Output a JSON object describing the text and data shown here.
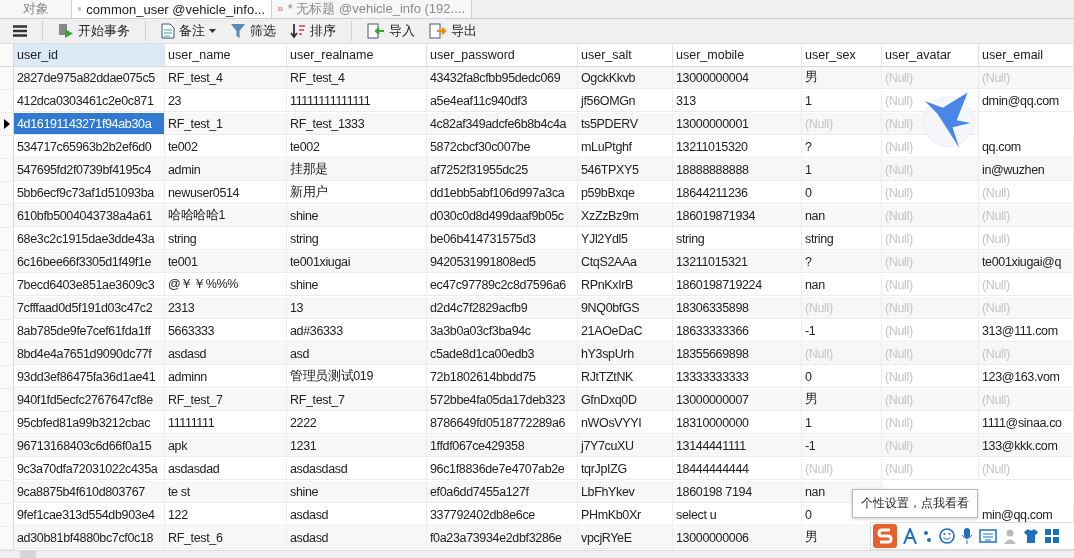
{
  "tabs": [
    {
      "label": "对象",
      "kind": "plain",
      "selected": false
    },
    {
      "label": "common_user @vehicle_info...",
      "kind": "table",
      "selected": true
    },
    {
      "label": "* 无标题 @vehicle_info (192....",
      "kind": "query",
      "selected": false
    }
  ],
  "toolbar": [
    {
      "kind": "menu"
    },
    {
      "kind": "transaction",
      "label": "开始事务"
    },
    {
      "kind": "note",
      "label": "备注"
    },
    {
      "kind": "filter",
      "label": "筛选"
    },
    {
      "kind": "sort",
      "label": "排序"
    },
    {
      "kind": "import",
      "label": "导入"
    },
    {
      "kind": "export",
      "label": "导出"
    }
  ],
  "table": {
    "columns": [
      "user_id",
      "user_name",
      "user_realname",
      "user_password",
      "user_salt",
      "user_mobile",
      "user_sex",
      "user_avatar",
      "user_email"
    ],
    "rows": [
      {
        "selected": false,
        "cells": [
          "2827de975a82ddae075c5",
          "RF_test_4",
          "RF_test_4",
          "43432fa8cfbb95dedc069",
          "OgckKkvb",
          "13000000004",
          "男",
          {
            "kind": "null",
            "text": "(Null)"
          },
          {
            "kind": "null",
            "text": "(Null)"
          }
        ]
      },
      {
        "selected": false,
        "cells": [
          "412dca0303461c2e0c871",
          "23",
          "11111111111111",
          "a5e4eaf11c940df3",
          "jf56OMGn",
          "313",
          "1",
          {
            "kind": "null",
            "text": "(Null)"
          },
          "dmin@qq.com"
        ]
      },
      {
        "selected": true,
        "cells": [
          "4d16191143271f94ab30a",
          "RF_test_1",
          "RF_test_1333",
          "4c82af349adcfe6b8b4c4a",
          "ts5PDERV",
          "13000000001",
          {
            "kind": "null",
            "text": "(Null)"
          },
          {
            "kind": "null",
            "text": "(Null)"
          },
          null
        ]
      },
      {
        "selected": false,
        "cells": [
          "534717c65963b2b2ef6d0",
          "te002",
          "te002",
          "5872cbcf30c007be",
          "mLuPtghf",
          "13211015320",
          "?",
          {
            "kind": "null",
            "text": "(Null)"
          },
          "qq.com"
        ]
      },
      {
        "selected": false,
        "cells": [
          "547695fd2f0739bf4195c4",
          "admin",
          "挂那是",
          "af7252f31955dc25",
          "546TPXY5",
          "18888888888",
          "1",
          {
            "kind": "null",
            "text": "(Null)"
          },
          "in@wuzhen"
        ]
      },
      {
        "selected": false,
        "cells": [
          "5bb6ecf9c73af1d51093ba",
          "newuser0514",
          "新用户",
          "dd1ebb5abf106d997a3ca",
          "p59bBxqe",
          "18644211236",
          "0",
          {
            "kind": "null",
            "text": "(Null)"
          },
          {
            "kind": "null",
            "text": "(Null)"
          }
        ]
      },
      {
        "selected": false,
        "cells": [
          "610bfb5004043738a4a61",
          "哈哈哈哈1",
          "shine",
          "d030c0d8d499daaf9b05c",
          "XzZzBz9m",
          "186019871934",
          "nan",
          {
            "kind": "null",
            "text": "(Null)"
          },
          {
            "kind": "null",
            "text": "(Null)"
          }
        ]
      },
      {
        "selected": false,
        "cells": [
          "68e3c2c1915dae3dde43a",
          "string",
          "string",
          "be06b414731575d3",
          "YJl2Ydl5",
          "string",
          "string",
          {
            "kind": "null",
            "text": "(Null)"
          },
          {
            "kind": "null",
            "text": "(Null)"
          }
        ]
      },
      {
        "selected": false,
        "cells": [
          "6c16bee66f3305d1f49f1e",
          "te001",
          "te001xiugai",
          "9420531991808ed5",
          "CtqS2AAa",
          "13211015321",
          "?",
          {
            "kind": "null",
            "text": "(Null)"
          },
          "te001xiugai@q"
        ]
      },
      {
        "selected": false,
        "cells": [
          "7becd6403e851ae3609c3",
          "@￥￥%%%",
          "shine",
          "ec47c97789c2c8d7596a6",
          "RPnKxIrB",
          "1860198719224",
          "nan",
          {
            "kind": "null",
            "text": "(Null)"
          },
          {
            "kind": "null",
            "text": "(Null)"
          }
        ]
      },
      {
        "selected": false,
        "cells": [
          "7cfffaad0d5f191d03c47c2",
          "2313",
          "13",
          "d2d4c7f2829acfb9",
          "9NQ0bfGS",
          "18306335898",
          {
            "kind": "null",
            "text": "(Null)"
          },
          {
            "kind": "null",
            "text": "(Null)"
          },
          {
            "kind": "null",
            "text": "(Null)"
          }
        ]
      },
      {
        "selected": false,
        "cells": [
          "8ab785de9fe7cef61fda1ff",
          "5663333",
          "ad#36333",
          "3a3b0a03cf3ba94c",
          "21AOeDaC",
          "18633333366",
          "-1",
          {
            "kind": "null",
            "text": "(Null)"
          },
          "313@111.com"
        ]
      },
      {
        "selected": false,
        "cells": [
          "8bd4e4a7651d9090dc77f",
          "asdasd",
          "asd",
          "c5ade8d1ca00edb3",
          "hY3spUrh",
          "18355669898",
          {
            "kind": "null",
            "text": "(Null)"
          },
          {
            "kind": "null",
            "text": "(Null)"
          },
          {
            "kind": "null",
            "text": "(Null)"
          }
        ]
      },
      {
        "selected": false,
        "cells": [
          "93dd3ef86475fa36d1ae41",
          "adminn",
          "管理员测试019",
          "72b1802614bbdd75",
          "RJtTZtNK",
          "13333333333",
          "0",
          {
            "kind": "null",
            "text": "(Null)"
          },
          "123@163.vom"
        ]
      },
      {
        "selected": false,
        "cells": [
          "940f1fd5ecfc2767647cf8e",
          "RF_test_7",
          "RF_test_7",
          "572bbe4fa05da17deb323",
          "GfnDxq0D",
          "13000000007",
          "男",
          {
            "kind": "null",
            "text": "(Null)"
          },
          {
            "kind": "null",
            "text": "(Null)"
          }
        ]
      },
      {
        "selected": false,
        "cells": [
          "95cbfed81a99b3212cbac",
          "11111111",
          "2222",
          "8786649fd0518772289a6",
          "nWOsVYYI",
          "18310000000",
          "1",
          {
            "kind": "null",
            "text": "(Null)"
          },
          "1111@sinaa.co"
        ]
      },
      {
        "selected": false,
        "cells": [
          "96713168403c6d66f0a15",
          "apk",
          "1231",
          "1ffdf067ce429358",
          "j7Y7cuXU",
          "13144441111",
          "-1",
          {
            "kind": "null",
            "text": "(Null)"
          },
          "133@kkk.com"
        ]
      },
      {
        "selected": false,
        "cells": [
          "9c3a70dfa72031022c435a",
          "asdasdad",
          "asdasdasd",
          "96c1f8836de7e4707ab2e",
          "tqrJpIZG",
          "18444444444",
          {
            "kind": "null",
            "text": "(Null)"
          },
          {
            "kind": "null",
            "text": "(Null)"
          },
          {
            "kind": "null",
            "text": "(Null)"
          }
        ]
      },
      {
        "selected": false,
        "cells": [
          "9ca8875b4f610d803767",
          "te st",
          "shine",
          "ef0a6dd7455a127f",
          "LbFhYkev",
          "1860198 7194",
          "nan",
          null,
          null
        ]
      },
      {
        "selected": false,
        "cells": [
          "9fef1cae313d554db903e4",
          "122",
          "asdasd",
          "337792402db8e6ce",
          "PHmKb0Xr",
          "select  u",
          "0",
          null,
          "min@qq.com"
        ]
      },
      {
        "selected": false,
        "cells": [
          "ad30b81bf4880bc7cf0c18",
          "RF_test_6",
          "asdasd",
          "f0a23a73934e2dbf3286e",
          "vpcjRYeE",
          "13000000006",
          "男",
          null,
          null
        ]
      }
    ]
  },
  "tooltip": {
    "text": "个性设置，点我看看"
  }
}
